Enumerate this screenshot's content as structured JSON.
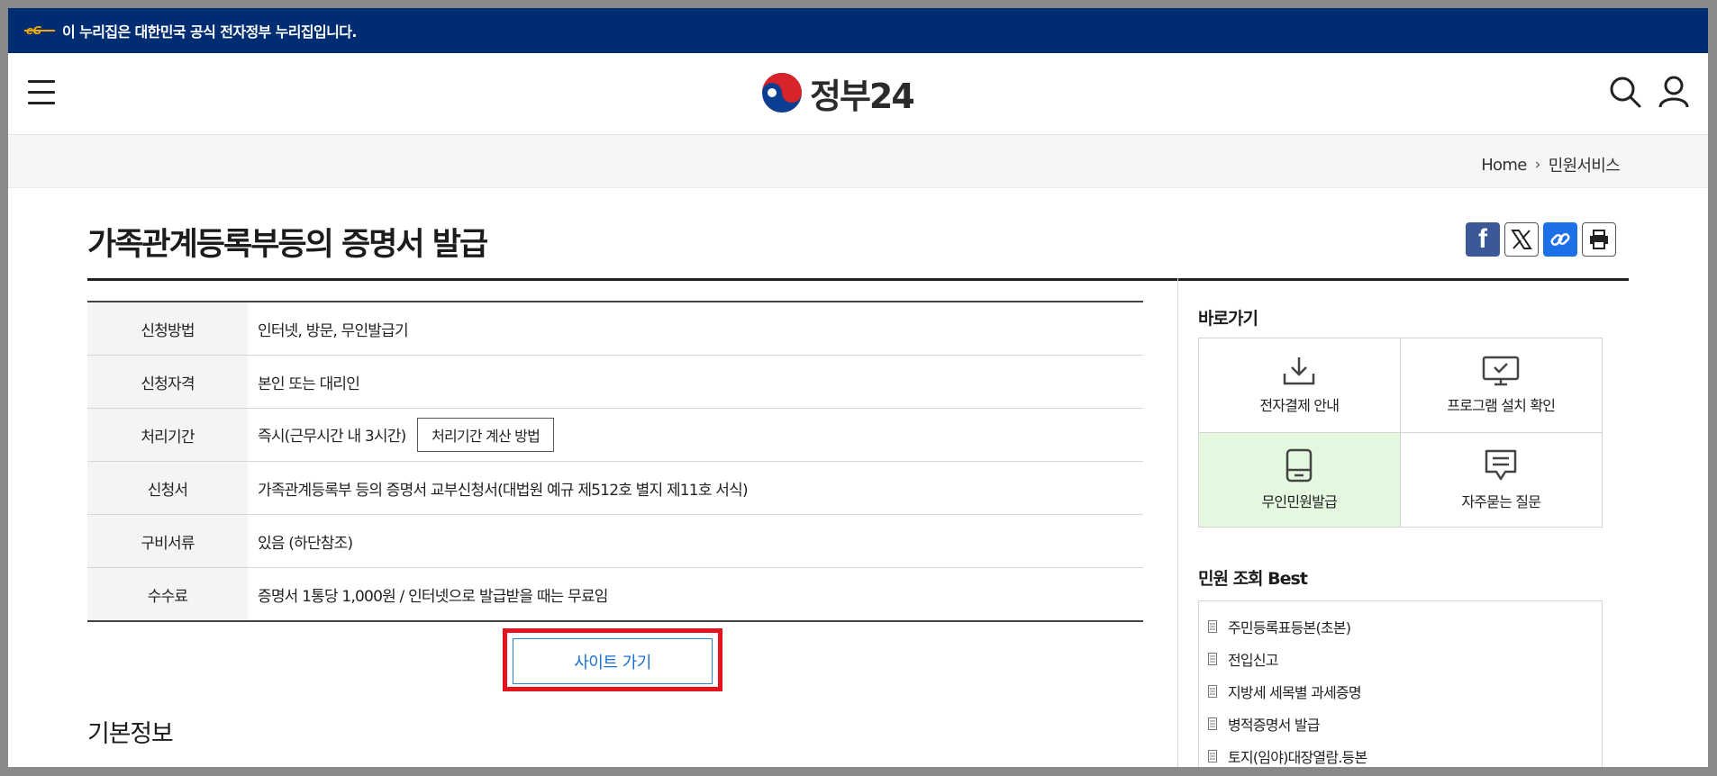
{
  "gov_bar": {
    "text": "이 누리집은 대한민국 공식 전자정부 누리집입니다.",
    "mark": "eG"
  },
  "header": {
    "logo_text": "정부24"
  },
  "breadcrumb": {
    "home": "Home",
    "current": "민원서비스"
  },
  "page": {
    "title": "가족관계등록부등의 증명서 발급"
  },
  "info_table": {
    "rows": [
      {
        "label": "신청방법",
        "value": "인터넷, 방문, 무인발급기"
      },
      {
        "label": "신청자격",
        "value": "본인 또는 대리인"
      },
      {
        "label": "처리기간",
        "value": "즉시(근무시간 내 3시간)",
        "button": "처리기간 계산 방법"
      },
      {
        "label": "신청서",
        "value": "가족관계등록부 등의 증명서 교부신청서(대법원 예규 제512호 별지 제11호 서식)"
      },
      {
        "label": "구비서류",
        "value": "있음 (하단참조)"
      },
      {
        "label": "수수료",
        "value": "증명서 1통당 1,000원 / 인터넷으로 발급받을 때는 무료임"
      }
    ]
  },
  "site_button": "사이트 가기",
  "basic_info_title": "기본정보",
  "sidebar": {
    "quick_title": "바로가기",
    "quick_links": [
      {
        "label": "전자결제 안내",
        "icon": "download-icon"
      },
      {
        "label": "프로그램 설치 확인",
        "icon": "monitor-check-icon"
      },
      {
        "label": "무인민원발급",
        "icon": "kiosk-icon"
      },
      {
        "label": "자주묻는 질문",
        "icon": "chat-icon"
      }
    ],
    "best_title": "민원 조회 Best",
    "best_items": [
      "주민등록표등본(초본)",
      "전입신고",
      "지방세 세목별 과세증명",
      "병적증명서 발급",
      "토지(임야)대장열람.등본"
    ]
  },
  "colors": {
    "gov_bar": "#002d72",
    "accent_blue": "#1a6fd2",
    "highlight_red": "#e3141e",
    "active_cell": "#e4f8e0"
  }
}
